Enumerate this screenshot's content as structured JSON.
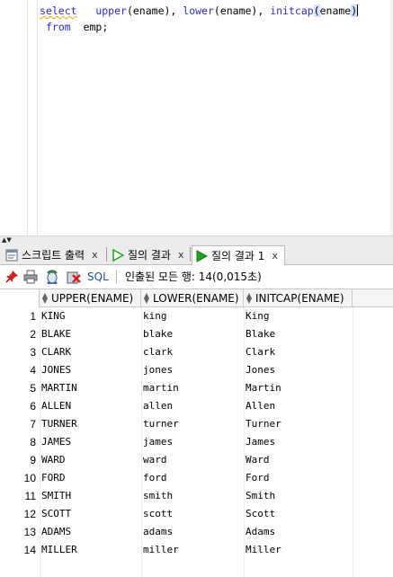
{
  "editor": {
    "line1": {
      "kw_select": "select",
      "fn_upper": "upper",
      "arg1": "(ename), ",
      "fn_lower": "lower",
      "arg2": "(ename), ",
      "fn_initcap": "initcap",
      "paren_open": "(",
      "arg3": "ename",
      "paren_close": ")"
    },
    "line2": {
      "kw_from": "from",
      "table": "emp;"
    }
  },
  "tabs": [
    {
      "label": "스크립트 출력",
      "close": "x",
      "icon": "script-output-icon",
      "active": false
    },
    {
      "label": "질의 결과",
      "close": "x",
      "icon": "run-green-icon",
      "active": false
    },
    {
      "label": "질의 결과 1",
      "close": "x",
      "icon": "run-green-icon",
      "active": true
    }
  ],
  "toolbar": {
    "sql_label": "SQL",
    "status": "인출된 모든 행: 14(0,015초)",
    "icons": [
      "pin-icon",
      "print-icon",
      "refresh-icon",
      "cancel-icon"
    ]
  },
  "grid": {
    "columns": [
      "UPPER(ENAME)",
      "LOWER(ENAME)",
      "INITCAP(ENAME)"
    ],
    "rows": [
      [
        "1",
        "KING",
        "king",
        "King"
      ],
      [
        "2",
        "BLAKE",
        "blake",
        "Blake"
      ],
      [
        "3",
        "CLARK",
        "clark",
        "Clark"
      ],
      [
        "4",
        "JONES",
        "jones",
        "Jones"
      ],
      [
        "5",
        "MARTIN",
        "martin",
        "Martin"
      ],
      [
        "6",
        "ALLEN",
        "allen",
        "Allen"
      ],
      [
        "7",
        "TURNER",
        "turner",
        "Turner"
      ],
      [
        "8",
        "JAMES",
        "james",
        "James"
      ],
      [
        "9",
        "WARD",
        "ward",
        "Ward"
      ],
      [
        "10",
        "FORD",
        "ford",
        "Ford"
      ],
      [
        "11",
        "SMITH",
        "smith",
        "Smith"
      ],
      [
        "12",
        "SCOTT",
        "scott",
        "Scott"
      ],
      [
        "13",
        "ADAMS",
        "adams",
        "Adams"
      ],
      [
        "14",
        "MILLER",
        "miller",
        "Miller"
      ]
    ]
  },
  "colors": {
    "keyword": "#2b2bd6",
    "accent_green": "#1fa31f",
    "sql_link": "#1a52a8"
  }
}
